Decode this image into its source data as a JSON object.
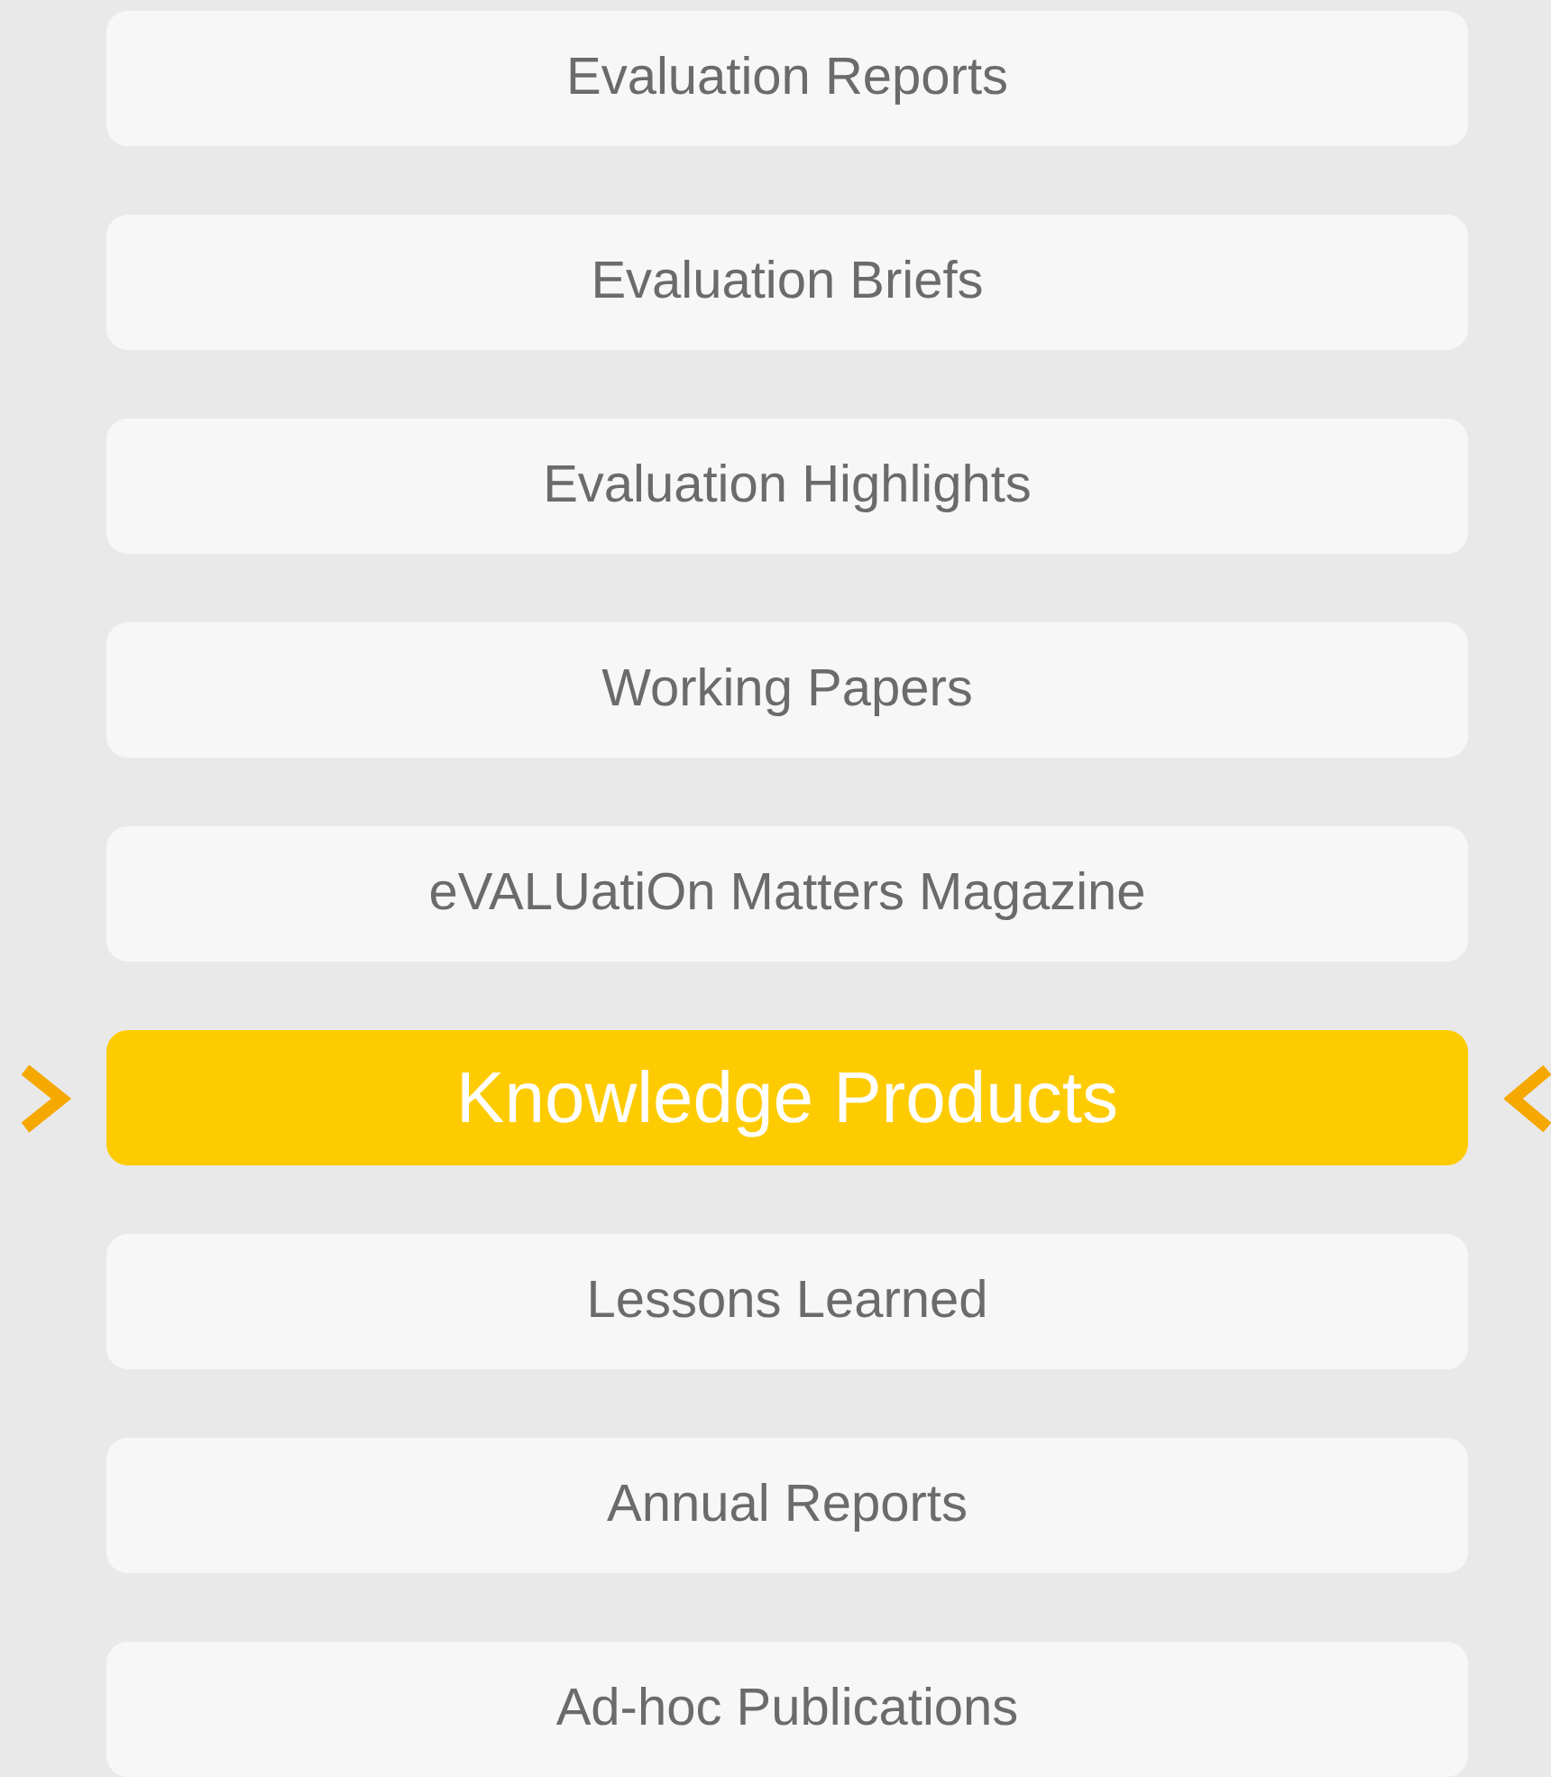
{
  "menu": [
    {
      "label": "Evaluation Reports",
      "selected": false
    },
    {
      "label": "Evaluation Briefs",
      "selected": false
    },
    {
      "label": "Evaluation Highlights",
      "selected": false
    },
    {
      "label": "Working Papers",
      "selected": false
    },
    {
      "label": "eVALUatiOn Matters Magazine",
      "selected": false
    },
    {
      "label": "Knowledge Products",
      "selected": true
    },
    {
      "label": "Lessons Learned",
      "selected": false
    },
    {
      "label": "Annual Reports",
      "selected": false
    },
    {
      "label": "Ad-hoc Publications",
      "selected": false
    }
  ]
}
